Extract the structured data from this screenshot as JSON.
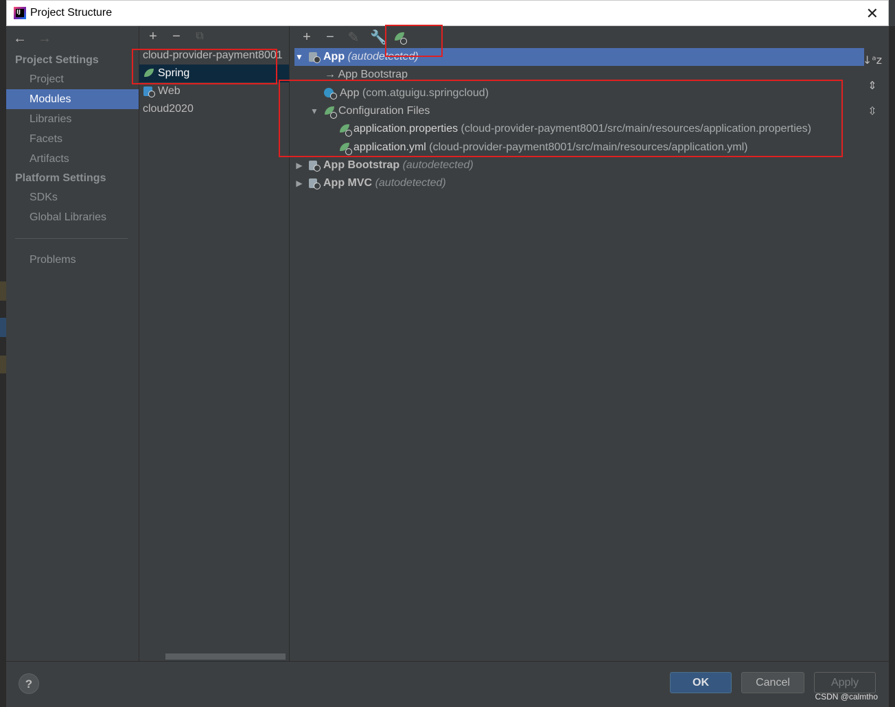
{
  "window": {
    "title": "Project Structure"
  },
  "nav": {
    "project_settings_header": "Project Settings",
    "project_items": [
      "Project",
      "Modules",
      "Libraries",
      "Facets",
      "Artifacts"
    ],
    "platform_settings_header": "Platform Settings",
    "platform_items": [
      "SDKs",
      "Global Libraries"
    ],
    "problems": "Problems",
    "selected": "Modules"
  },
  "modules": {
    "items": [
      {
        "label": "cloud-provider-payment8001",
        "icon": "module-icon"
      },
      {
        "label": "Spring",
        "icon": "spring-leaf-icon"
      },
      {
        "label": "Web",
        "icon": "web-icon"
      },
      {
        "label": "cloud2020",
        "icon": ""
      }
    ],
    "selected": "Spring"
  },
  "tree": {
    "rows": [
      {
        "expander": "▼",
        "label": "App",
        "hint": "(autodetected)",
        "selected": true
      },
      {
        "label": "→ App Bootstrap"
      },
      {
        "label": "App",
        "path": "(com.atguigu.springcloud)"
      },
      {
        "expander": "▼",
        "label": "Configuration Files"
      },
      {
        "label": "application.properties",
        "path": "(cloud-provider-payment8001/src/main/resources/application.properties)"
      },
      {
        "label": "application.yml",
        "path": "(cloud-provider-payment8001/src/main/resources/application.yml)"
      },
      {
        "expander": "▶",
        "label": "App Bootstrap",
        "hint": "(autodetected)"
      },
      {
        "expander": "▶",
        "label": "App MVC",
        "hint": "(autodetected)"
      }
    ]
  },
  "buttons": {
    "ok": "OK",
    "cancel": "Cancel",
    "apply": "Apply",
    "help": "?"
  },
  "watermark": "CSDN @calmtho",
  "colors": {
    "selection": "#4b6eaf",
    "module_selection": "#0d293e",
    "annotation": "#e02020",
    "spring_green": "#6aab73"
  }
}
